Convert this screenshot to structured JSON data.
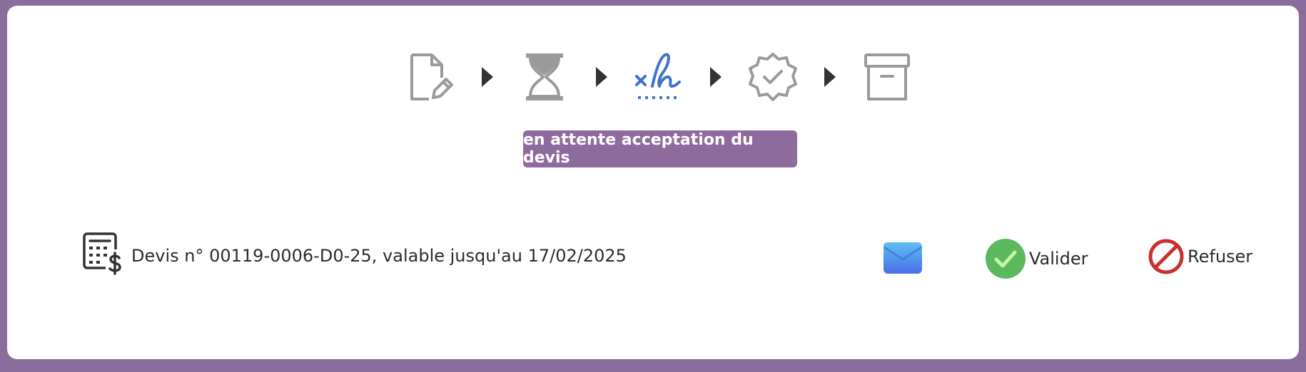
{
  "workflow": {
    "steps": [
      {
        "icon": "document-edit-icon",
        "state": "done"
      },
      {
        "icon": "hourglass-icon",
        "state": "done"
      },
      {
        "icon": "signature-icon",
        "state": "current"
      },
      {
        "icon": "certified-badge-icon",
        "state": "pending"
      },
      {
        "icon": "archive-box-icon",
        "state": "pending"
      }
    ],
    "separator_icon": "triangle-right-icon",
    "status_label": "en attente acceptation du devis"
  },
  "quote": {
    "icon": "quote-calculator-icon",
    "text": "Devis n° 00119-0006-D0-25, valable jusqu'au 17/02/2025"
  },
  "actions": {
    "mail_icon": "envelope-icon",
    "validate_label": "Valider",
    "refuse_label": "Refuser"
  },
  "colors": {
    "frame": "#8a6d9c",
    "badge": "#8d6b9c",
    "current_step": "#3f72c8",
    "inactive_step": "#9a9a9a",
    "validate": "#5cb85c",
    "refuse": "#c9302c",
    "mail": "#4a86f0"
  }
}
